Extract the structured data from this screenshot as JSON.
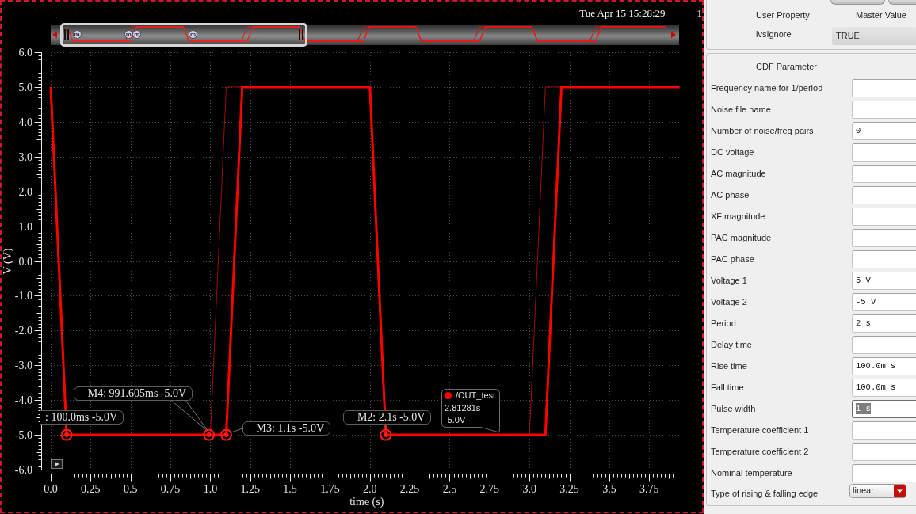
{
  "plot": {
    "date": "Tue Apr 15 15:28:29",
    "header_fragment": "1",
    "overview": {
      "markers": [
        {
          "label": "m"
        },
        {
          "label": "m"
        },
        {
          "label": "m"
        },
        {
          "label": "m"
        }
      ]
    },
    "chart_data": {
      "type": "line",
      "xlabel": "time (s)",
      "ylabel": "V (V)",
      "grid": true,
      "x": [
        0,
        0.1,
        1.0,
        1.1,
        1.2,
        2.0,
        2.1,
        3.0,
        3.1,
        3.2,
        3.94
      ],
      "series": [
        {
          "color": "#ff0000",
          "values": [
            5,
            -5,
            -5,
            -5,
            5,
            5,
            -5,
            -5,
            -5,
            5,
            5
          ]
        },
        {
          "color": "#a00c0c",
          "values": [
            5,
            -5,
            -5,
            5,
            5,
            5,
            -5,
            -5,
            5,
            5,
            5
          ]
        }
      ],
      "xlim": [
        0,
        3.94
      ],
      "ylim": [
        -6,
        6
      ],
      "xticks": [
        {
          "value": 0,
          "label": "0.0"
        },
        {
          "value": 0.25,
          "label": "0.25"
        },
        {
          "value": 0.5,
          "label": "0.5"
        },
        {
          "value": 0.75,
          "label": "0.75"
        },
        {
          "value": 1,
          "label": "1.0"
        },
        {
          "value": 1.25,
          "label": "1.25"
        },
        {
          "value": 1.5,
          "label": "1.5"
        },
        {
          "value": 1.75,
          "label": "1.75"
        },
        {
          "value": 2,
          "label": "2.0"
        },
        {
          "value": 2.25,
          "label": "2.25"
        },
        {
          "value": 2.5,
          "label": "2.5"
        },
        {
          "value": 2.75,
          "label": "2.75"
        },
        {
          "value": 3,
          "label": "3.0"
        },
        {
          "value": 3.25,
          "label": "3.25"
        },
        {
          "value": 3.5,
          "label": "3.5"
        },
        {
          "value": 3.75,
          "label": "3.75"
        }
      ],
      "yticks": [
        {
          "value": 6,
          "label": "6.0"
        },
        {
          "value": 5,
          "label": "5.0"
        },
        {
          "value": 4,
          "label": "4.0"
        },
        {
          "value": 3,
          "label": "3.0"
        },
        {
          "value": 2,
          "label": "2.0"
        },
        {
          "value": 1,
          "label": "1.0"
        },
        {
          "value": 0,
          "label": "0.0"
        },
        {
          "value": -1,
          "label": "-1.0"
        },
        {
          "value": -2,
          "label": "-2.0"
        },
        {
          "value": -3,
          "label": "-3.0"
        },
        {
          "value": -4,
          "label": "-4.0"
        },
        {
          "value": -5,
          "label": "-5.0"
        },
        {
          "value": -6,
          "label": "-6.0"
        }
      ],
      "annotations": [
        {
          "text": ": 100.0ms -5.0V",
          "x": 0.1,
          "y": -5.0
        },
        {
          "text": "M4: 991.605ms -5.0V",
          "x": 0.991605,
          "y": -5.0
        },
        {
          "text": "M3: 1.1s -5.0V",
          "x": 1.1,
          "y": -5.0
        },
        {
          "text": "M2: 2.1s -5.0V",
          "x": 2.1,
          "y": -5.0
        }
      ]
    },
    "cursor_tooltip": {
      "trace": "/OUT_test",
      "color": "#ff0000",
      "time": "2.81281s",
      "value": "-5.0V"
    }
  },
  "properties": {
    "user_properties": {
      "columns": [
        "User Property",
        "Master Value"
      ],
      "rows": [
        {
          "name": "lvsIgnore",
          "value": "TRUE"
        }
      ]
    },
    "cdf_parameters": {
      "title": "CDF Parameter",
      "rows": [
        {
          "kind": "field",
          "label": "Frequency name for 1/period",
          "focused": false
        },
        {
          "kind": "field",
          "label": "Noise file name",
          "focused": false
        },
        {
          "kind": "field",
          "label": "Number of noise/freq pairs",
          "value": "0",
          "focused": false
        },
        {
          "kind": "field",
          "label": "DC voltage",
          "focused": false
        },
        {
          "kind": "field",
          "label": "AC magnitude",
          "focused": false
        },
        {
          "kind": "field",
          "label": "AC phase",
          "focused": false
        },
        {
          "kind": "field",
          "label": "XF magnitude",
          "focused": false
        },
        {
          "kind": "field",
          "label": "PAC magnitude",
          "focused": false
        },
        {
          "kind": "field",
          "label": "PAC phase",
          "focused": false
        },
        {
          "kind": "field",
          "label": "Voltage 1",
          "value": "5 V",
          "focused": false
        },
        {
          "kind": "field",
          "label": "Voltage 2",
          "value": "-5 V",
          "focused": false
        },
        {
          "kind": "field",
          "label": "Period",
          "value": "2 s",
          "focused": false
        },
        {
          "kind": "field",
          "label": "Delay time",
          "focused": false
        },
        {
          "kind": "field",
          "label": "Rise time",
          "value": "100.0m s",
          "focused": false
        },
        {
          "kind": "field",
          "label": "Fall time",
          "value": "100.0m s",
          "focused": false
        },
        {
          "kind": "field",
          "label": "Pulse width",
          "value": "1 s",
          "focused": true
        },
        {
          "kind": "field",
          "label": "Temperature coefficient 1",
          "focused": false
        },
        {
          "kind": "field",
          "label": "Temperature coefficient 2",
          "focused": false
        },
        {
          "kind": "field",
          "label": "Nominal temperature",
          "focused": false
        },
        {
          "kind": "dropdown",
          "label": "Type of rising & falling edge",
          "value": "linear",
          "focused": false
        }
      ]
    }
  }
}
